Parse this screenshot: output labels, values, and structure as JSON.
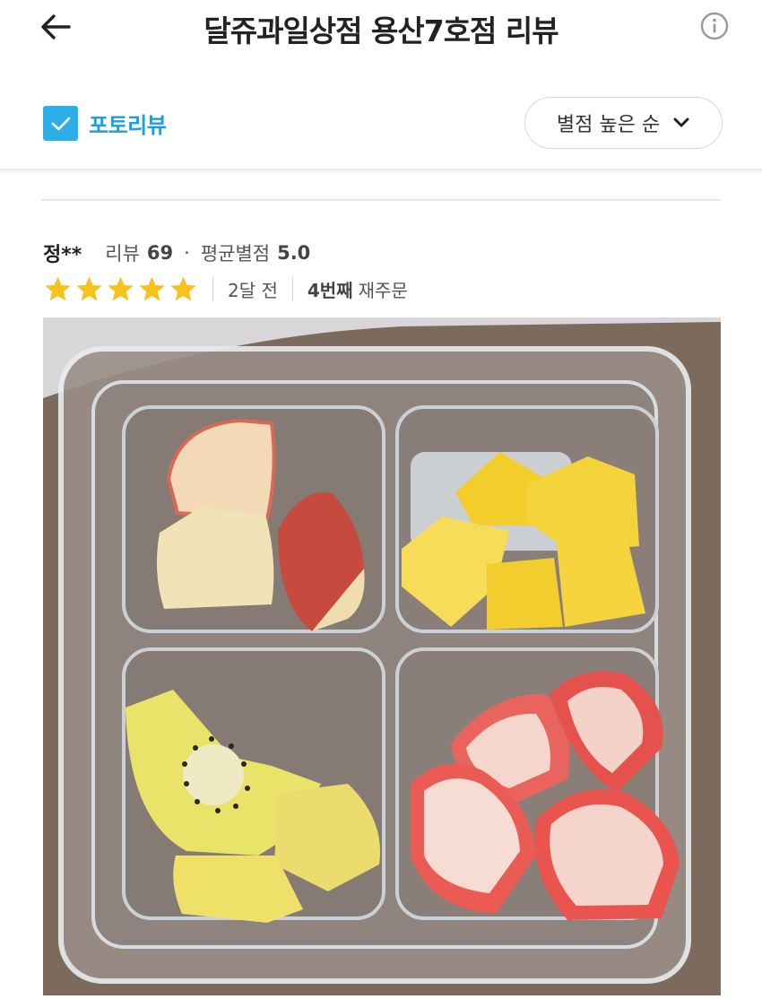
{
  "header": {
    "title": "달쥬과일상점 용산7호점 리뷰",
    "back_icon": "arrow-left-icon",
    "info_icon": "info-circle-icon"
  },
  "filter": {
    "photo_review_label": "포토리뷰",
    "photo_review_checked": true,
    "sort_label": "별점 높은 순",
    "accent_color": "#2caee8"
  },
  "review": {
    "reviewer_name": "정**",
    "review_count_label": "리뷰",
    "review_count": "69",
    "avg_rating_label": "평균별점",
    "avg_rating": "5.0",
    "stars": 5,
    "star_color": "#f8c21c",
    "date": "2달 전",
    "reorder_count": "4번째",
    "reorder_label": "재주문",
    "photo_description": "plastic container with apple, pineapple, kiwi and strawberry pieces"
  }
}
